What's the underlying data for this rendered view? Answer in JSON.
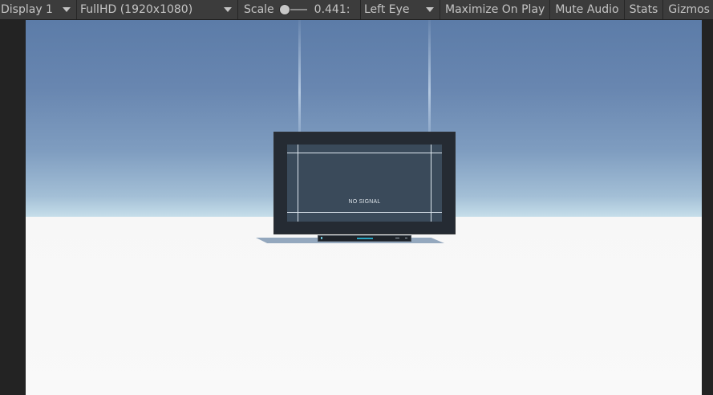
{
  "toolbar": {
    "display": "Display 1",
    "resolution": "FullHD (1920x1080)",
    "scale_label": "Scale",
    "scale_value": "0.441",
    "scale_suffix": ":",
    "eye": "Left Eye",
    "maximize_on_play": "Maximize On Play",
    "mute_audio": "Mute Audio",
    "stats": "Stats",
    "gizmos": "Gizmos"
  },
  "scene": {
    "monitor_text": "NO SIGNAL"
  },
  "colors": {
    "toolbar_bg": "#3c3c3c",
    "sky_top": "#5c7ca8",
    "ground": "#fafafa",
    "screen": "#3a4a5a"
  }
}
